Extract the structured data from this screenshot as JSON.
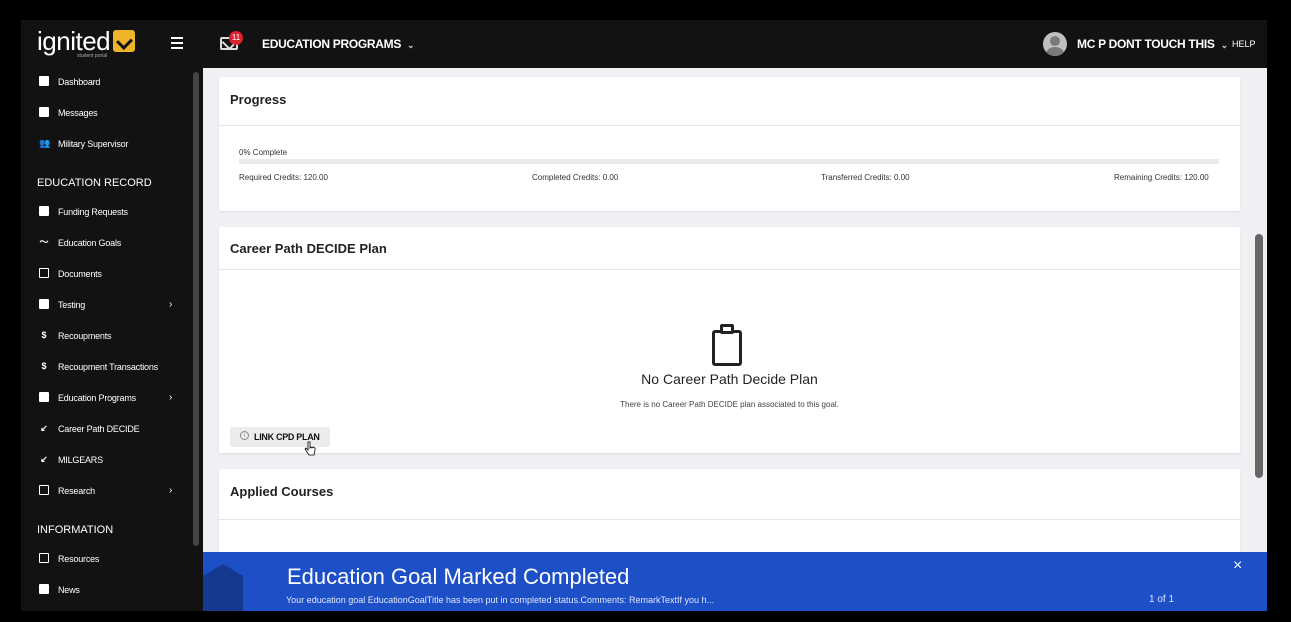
{
  "header": {
    "logo_text": "ignited",
    "logo_sub": "student portal",
    "mail_count": "11",
    "programs_menu": "EDUCATION PROGRAMS",
    "user_name": "MC P DONT TOUCH THIS",
    "help": "HELP"
  },
  "sidebar": {
    "items_top": [
      {
        "label": "Dashboard",
        "icon": "dashboard-icon"
      },
      {
        "label": "Messages",
        "icon": "message-icon"
      },
      {
        "label": "Military Supervisor",
        "icon": "users-icon"
      }
    ],
    "section_education": "EDUCATION RECORD",
    "items_education": [
      {
        "label": "Funding Requests",
        "icon": "funding-icon"
      },
      {
        "label": "Education Goals",
        "icon": "trend-icon"
      },
      {
        "label": "Documents",
        "icon": "document-icon"
      },
      {
        "label": "Testing",
        "icon": "testing-icon"
      },
      {
        "label": "Recoupments",
        "icon": "dollar-icon"
      },
      {
        "label": "Recoupment Transactions",
        "icon": "dollar-icon"
      },
      {
        "label": "Education Programs",
        "icon": "calendar-icon"
      },
      {
        "label": "Career Path DECIDE",
        "icon": "arrow-icon"
      },
      {
        "label": "MILGEARS",
        "icon": "arrow-icon"
      },
      {
        "label": "Research",
        "icon": "research-icon"
      }
    ],
    "section_information": "INFORMATION",
    "items_information": [
      {
        "label": "Resources",
        "icon": "document-icon"
      },
      {
        "label": "News",
        "icon": "news-icon"
      }
    ]
  },
  "progress": {
    "title": "Progress",
    "percent_label": "0% Complete",
    "percent_value": 0,
    "required": "Required Credits: 120.00",
    "completed": "Completed Credits: 0.00",
    "transferred": "Transferred Credits: 0.00",
    "remaining": "Remaining Credits: 120.00"
  },
  "cpd": {
    "title": "Career Path DECIDE Plan",
    "empty_title": "No Career Path Decide Plan",
    "empty_desc": "There is no Career Path DECIDE plan associated to this goal.",
    "link_button": "LINK CPD PLAN"
  },
  "applied": {
    "title": "Applied Courses"
  },
  "toast": {
    "title": "Education Goal Marked Completed",
    "text": "Your education goal EducationGoalTitle has been put in completed status.Comments: RemarkTextIf you h...",
    "count": "1 of 1",
    "close": "×"
  }
}
